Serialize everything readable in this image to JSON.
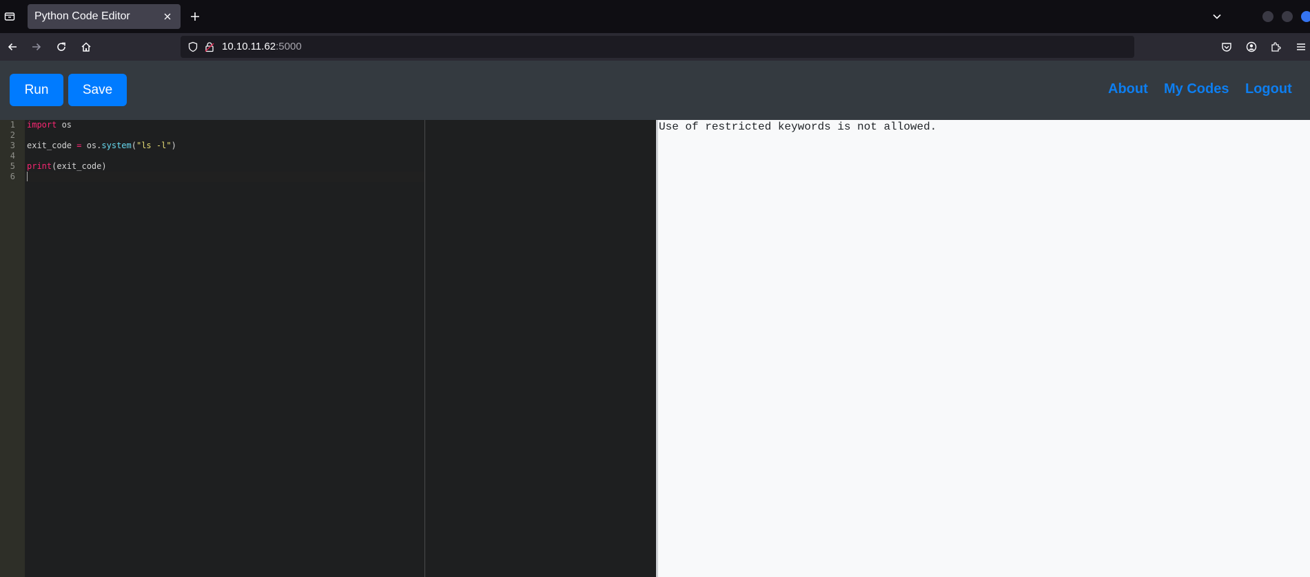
{
  "browser": {
    "tab": {
      "title": "Python Code Editor"
    },
    "url": {
      "host": "10.10.11.62",
      "port": ":5000"
    }
  },
  "header": {
    "run_label": "Run",
    "save_label": "Save",
    "nav": {
      "about": "About",
      "my_codes": "My Codes",
      "logout": "Logout"
    }
  },
  "editor": {
    "line_numbers": [
      "1",
      "2",
      "3",
      "4",
      "5",
      "6"
    ],
    "code": {
      "l1_kw": "import",
      "l1_rest": " os",
      "l3_a": "exit_code ",
      "l3_op": "=",
      "l3_b": " os.",
      "l3_fn": "system",
      "l3_paren_open": "(",
      "l3_str": "\"ls -l\"",
      "l3_paren_close": ")",
      "l5_fn": "print",
      "l5_rest": "(exit_code)"
    }
  },
  "output": {
    "text": "Use of restricted keywords is not allowed."
  },
  "colors": {
    "primary": "#007bff",
    "navbar": "#343a40",
    "editor_bg": "#1e1f20",
    "keyword": "#f92672",
    "function": "#66d9ef",
    "string": "#e6db74"
  }
}
